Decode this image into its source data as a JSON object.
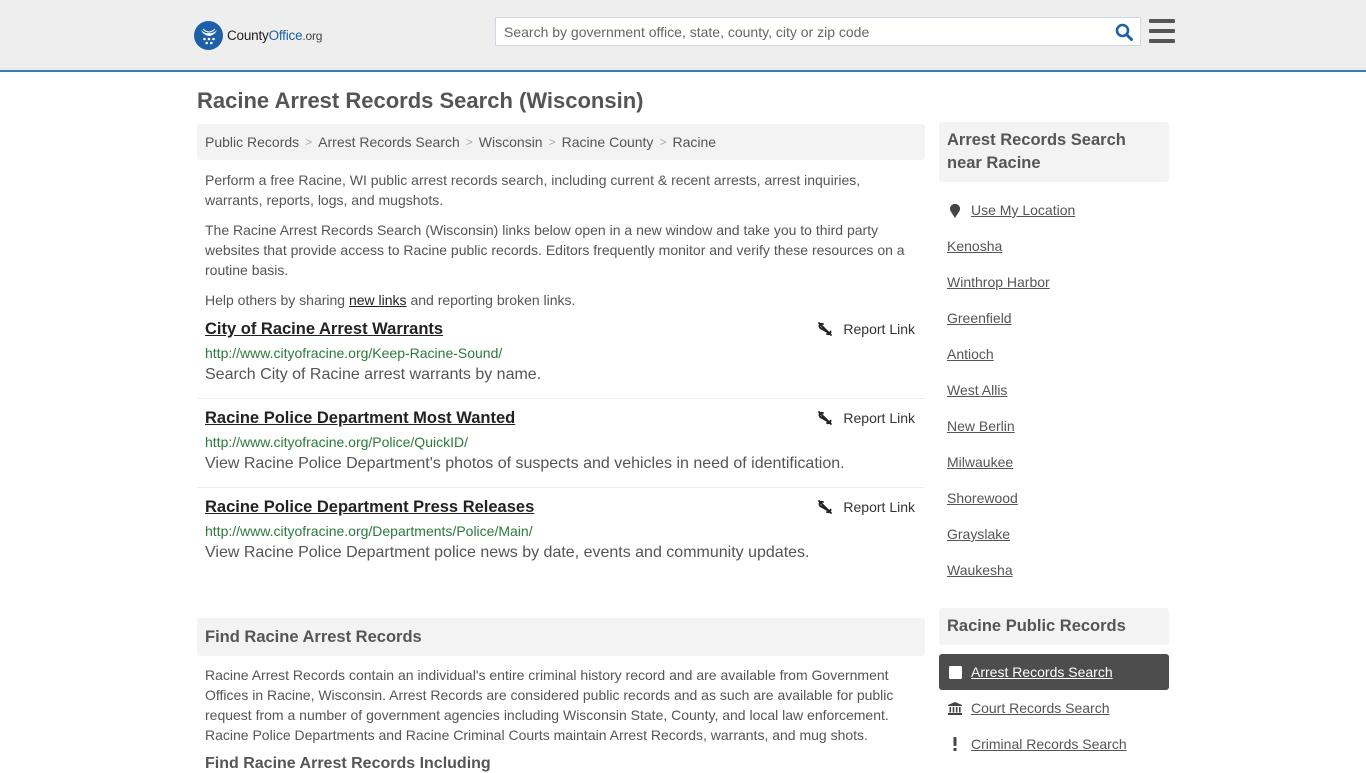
{
  "header": {
    "logo": {
      "prefix": "County",
      "brand": "Office",
      "tld": ".org"
    },
    "search": {
      "placeholder": "Search by government office, state, county, city or zip code",
      "value": ""
    },
    "icons": {
      "search": "search-icon",
      "menu": "hamburger-menu-icon"
    }
  },
  "page": {
    "title": "Racine Arrest Records Search (Wisconsin)"
  },
  "breadcrumb": [
    {
      "label": "Public Records"
    },
    {
      "label": "Arrest Records Search"
    },
    {
      "label": "Wisconsin"
    },
    {
      "label": "Racine County"
    },
    {
      "label": "Racine"
    }
  ],
  "intro": {
    "p1": "Perform a free Racine, WI public arrest records search, including current & recent arrests, arrest inquiries, warrants, reports, logs, and mugshots.",
    "p2": "The Racine Arrest Records Search (Wisconsin) links below open in a new window and take you to third party websites that provide access to Racine public records. Editors frequently monitor and verify these resources on a routine basis.",
    "p3_before": "Help others by sharing ",
    "p3_link": "new links",
    "p3_after": " and reporting broken links."
  },
  "listings": [
    {
      "title": "City of Racine Arrest Warrants",
      "url": "http://www.cityofracine.org/Keep-Racine-Sound/",
      "description": "Search City of Racine arrest warrants by name.",
      "report_label": "Report Link"
    },
    {
      "title": "Racine Police Department Most Wanted",
      "url": "http://www.cityofracine.org/Police/QuickID/",
      "description": "View Racine Police Department's photos of suspects and vehicles in need of identification.",
      "report_label": "Report Link"
    },
    {
      "title": "Racine Police Department Press Releases",
      "url": "http://www.cityofracine.org/Departments/Police/Main/",
      "description": "View Racine Police Department police news by date, events and community updates.",
      "report_label": "Report Link"
    }
  ],
  "find_section": {
    "heading": "Find Racine Arrest Records",
    "body": "Racine Arrest Records contain an individual's entire criminal history record and are available from Government Offices in Racine, Wisconsin. Arrest Records are considered public records and as such are available for public request from a number of government agencies including Wisconsin State, County, and local law enforcement. Racine Police Departments and Racine Criminal Courts maintain Arrest Records, warrants, and mug shots.",
    "subheading": "Find Racine Arrest Records Including"
  },
  "sidebar": {
    "nearby": {
      "heading": "Arrest Records Search near Racine",
      "use_location": "Use My Location",
      "cities": [
        "Kenosha",
        "Winthrop Harbor",
        "Greenfield",
        "Antioch",
        "West Allis",
        "New Berlin",
        "Milwaukee",
        "Shorewood",
        "Grayslake",
        "Waukesha"
      ]
    },
    "public_records": {
      "heading": "Racine Public Records",
      "items": [
        {
          "label": "Arrest Records Search",
          "icon": "square-icon",
          "active": true
        },
        {
          "label": "Court Records Search",
          "icon": "courthouse-icon",
          "active": false
        },
        {
          "label": "Criminal Records Search",
          "icon": "exclamation-icon",
          "active": false
        }
      ]
    }
  },
  "colors": {
    "brand_blue": "#1d5fa8",
    "header_border": "#3b7bb0",
    "url_green": "#2b7a3b",
    "active_item_bg": "#4d4d4d"
  }
}
